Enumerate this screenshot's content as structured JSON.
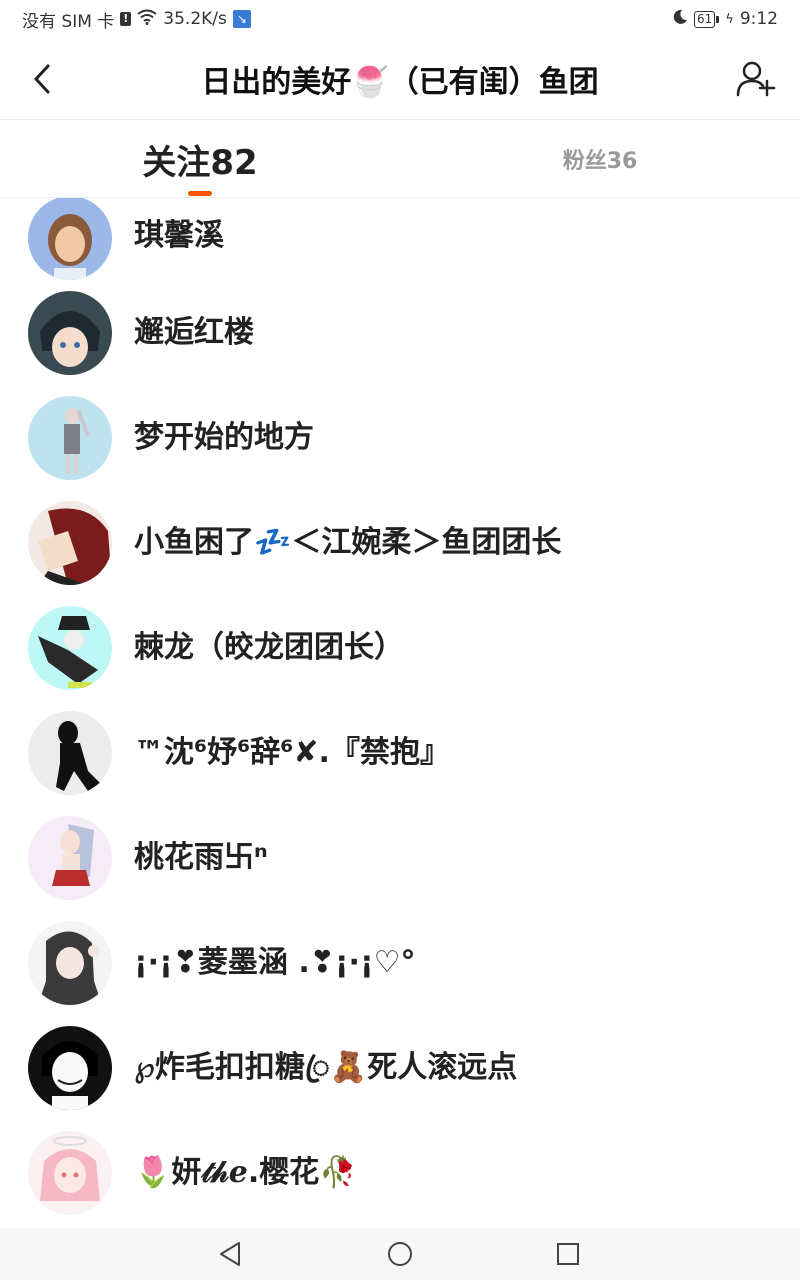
{
  "status": {
    "carrier": "没有 SIM 卡",
    "sim_icon_label": "!",
    "speed": "35.2K/s",
    "battery": "61",
    "time": "9:12"
  },
  "header": {
    "title": "日出的美好🍧（已有闺）鱼团"
  },
  "tabs": {
    "follow": "关注82",
    "fans": "粉丝36"
  },
  "icons": {
    "back": "back-arrow-icon",
    "add_user": "add-user-icon",
    "nav_back": "triangle-back-icon",
    "nav_home": "circle-home-icon",
    "nav_recent": "square-recent-icon"
  },
  "colors": {
    "accent": "#ff5500",
    "inactive_tab": "#999999"
  },
  "users": [
    {
      "name": "琪馨溪"
    },
    {
      "name": "邂逅红楼"
    },
    {
      "name": "梦开始的地方"
    },
    {
      "name": "小鱼困了💤＜江婉柔＞鱼团团长"
    },
    {
      "name": "棘龙（皎龙团团长）"
    },
    {
      "name": "™沈⁶妤⁶辞⁶✘.『禁抱』"
    },
    {
      "name": "桃花雨卐ⁿ"
    },
    {
      "name": "¡·¡❣菱墨涵 .❣¡·¡♡°"
    },
    {
      "name": "℘炸毛扣扣糖ꦿ🧸死人滚远点"
    },
    {
      "name": "🌷妍𝓉𝒽ℯ.樱花🥀"
    }
  ]
}
